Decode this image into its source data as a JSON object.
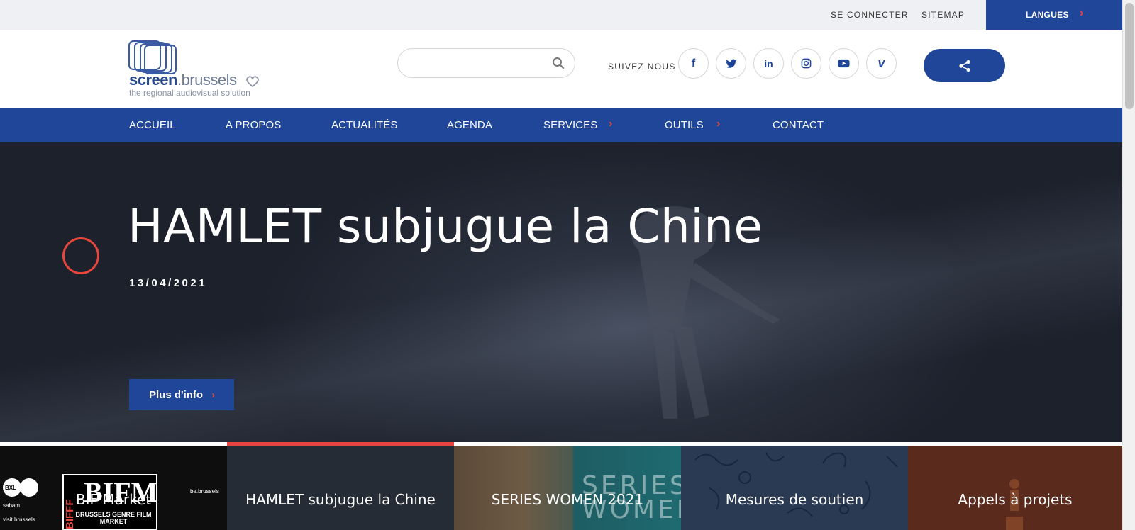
{
  "topbar": {
    "login": "SE CONNECTER",
    "sitemap": "SITEMAP",
    "languages": "LANGUES"
  },
  "header": {
    "logo_word_bold": "screen",
    "logo_word_thin": ".brussels",
    "logo_tagline": "the regional audiovisual solution",
    "search_placeholder": "",
    "follow_label": "SUIVEZ NOUS",
    "social": [
      {
        "icon": "facebook-icon",
        "glyph": "f"
      },
      {
        "icon": "twitter-icon",
        "glyph": ""
      },
      {
        "icon": "linkedin-icon",
        "glyph": "in"
      },
      {
        "icon": "instagram-icon",
        "glyph": ""
      },
      {
        "icon": "youtube-icon",
        "glyph": ""
      },
      {
        "icon": "vimeo-icon",
        "glyph": "v"
      }
    ]
  },
  "nav": {
    "items": [
      "ACCUEIL",
      "A PROPOS",
      "ACTUALITÉS",
      "AGENDA",
      "SERVICES",
      "OUTILS",
      "CONTACT"
    ]
  },
  "hero": {
    "title": "HAMLET subjugue la Chine",
    "date": "13/04/2021",
    "button": "Plus d'info"
  },
  "slider": {
    "active_index": 1,
    "tabs": [
      "BIF Market",
      "HAMLET subjugue la Chine",
      "SERIES WOMEN 2021",
      "Mesures de soutien",
      "Appels à projets"
    ],
    "thumb_texts": {
      "bifm_big": "BIFM",
      "bifm_sub": "BRUSSELS GENRE FILM MARKET",
      "bifm_vertical": "BIFFF",
      "bxl": "BXL",
      "sabam": "sabam",
      "visit": "visit.brussels",
      "be_brussels": "be.brussels",
      "series_women": "SERIES WOMEN"
    }
  },
  "colors": {
    "primary": "#1f4699",
    "accent": "#e8453c",
    "topbar_bg": "#eef0f3"
  }
}
